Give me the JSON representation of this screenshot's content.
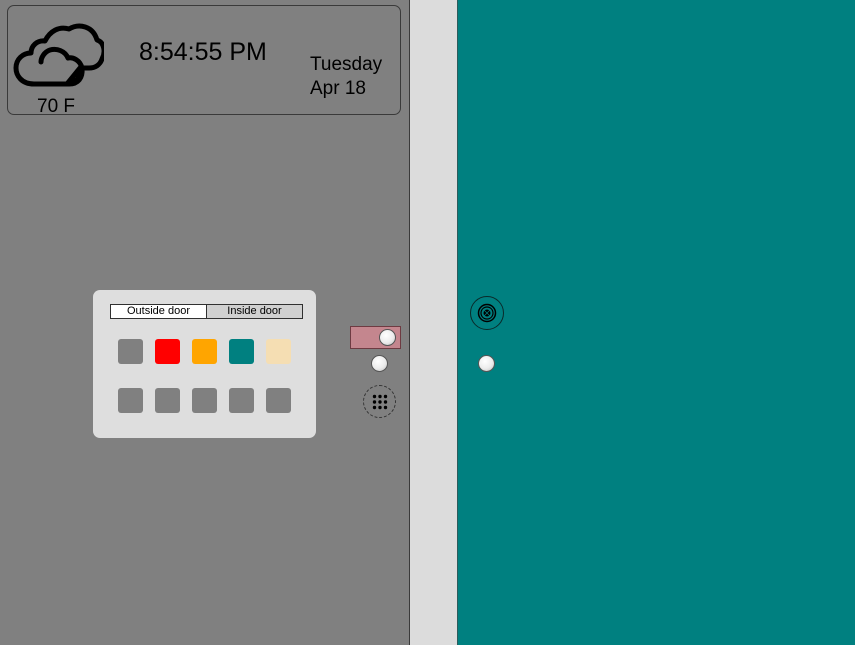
{
  "weather": {
    "temperature": "70 F",
    "icon": "cloud-icon"
  },
  "clock": {
    "time": "8:54:55 PM",
    "day": "Tuesday",
    "date": "Apr 18"
  },
  "color_picker": {
    "tabs": [
      {
        "label": "Outside door",
        "active": true
      },
      {
        "label": "Inside door",
        "active": false
      }
    ],
    "colors_row1": [
      "#808080",
      "#ff0000",
      "#ffa500",
      "#008080",
      "#f5deb3"
    ],
    "colors_row2": [
      "#808080",
      "#808080",
      "#808080",
      "#808080",
      "#808080"
    ]
  },
  "controls": {
    "toggle_color": "#c4868e",
    "keypad_icon": "keypad-icon",
    "peephole_icon": "peephole-icon"
  },
  "theme": {
    "outside_door": "#808080",
    "inside_door": "#008080",
    "frame": "#dcdcdc"
  }
}
